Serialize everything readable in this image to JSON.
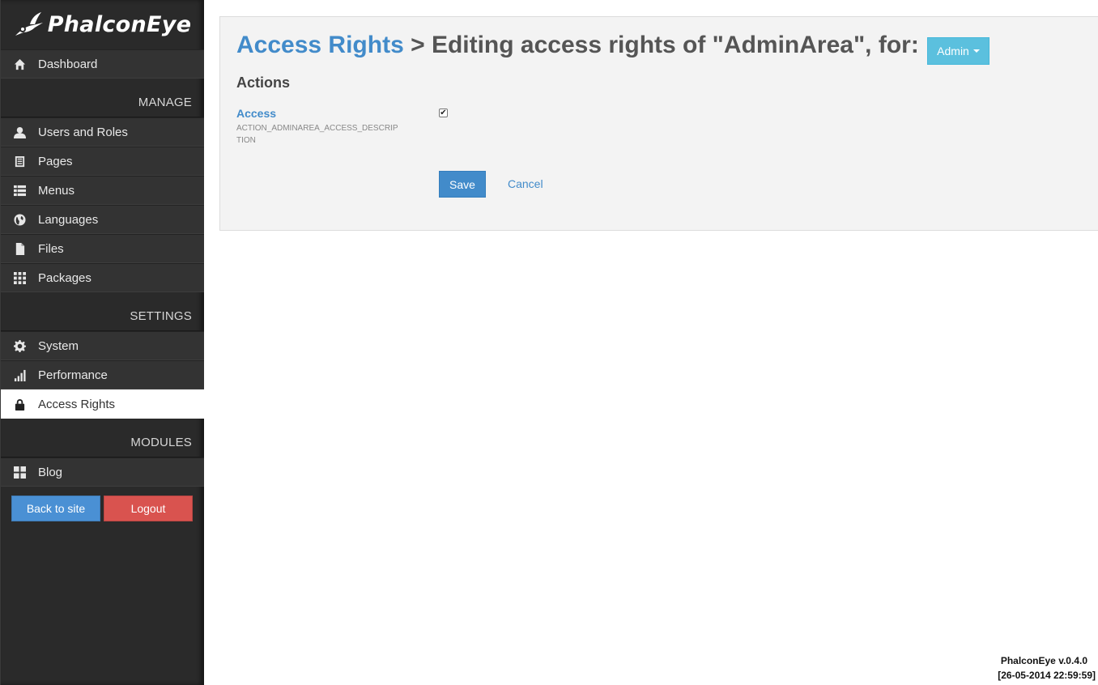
{
  "logo": {
    "text": "PhalconEye"
  },
  "sidebar": {
    "dashboard": {
      "label": "Dashboard",
      "icon": "home-icon"
    },
    "sections": {
      "manage": "MANAGE",
      "settings": "SETTINGS",
      "modules": "MODULES"
    },
    "manage_items": [
      {
        "label": "Users and Roles",
        "icon": "user-icon"
      },
      {
        "label": "Pages",
        "icon": "page-list-icon"
      },
      {
        "label": "Menus",
        "icon": "list-icon"
      },
      {
        "label": "Languages",
        "icon": "globe-icon"
      },
      {
        "label": "Files",
        "icon": "file-icon"
      },
      {
        "label": "Packages",
        "icon": "grid-icon"
      }
    ],
    "settings_items": [
      {
        "label": "System",
        "icon": "gear-icon"
      },
      {
        "label": "Performance",
        "icon": "signal-bars-icon"
      },
      {
        "label": "Access Rights",
        "icon": "lock-icon",
        "active": true
      }
    ],
    "modules_items": [
      {
        "label": "Blog",
        "icon": "tiles-icon"
      }
    ],
    "buttons": {
      "back": "Back to site",
      "logout": "Logout"
    }
  },
  "main": {
    "breadcrumb_link": "Access Rights",
    "title_rest": " > Editing access rights of \"AdminArea\", for:",
    "role_dropdown": "Admin",
    "actions_heading": "Actions",
    "permission": {
      "label": "Access",
      "description": "ACTION_ADMINAREA_ACCESS_DESCRIPTION",
      "checked": true
    },
    "save_label": "Save",
    "cancel_label": "Cancel"
  },
  "footer": {
    "version": "PhalconEye v.0.4.0",
    "timestamp": "[26-05-2014 22:59:59]"
  },
  "colors": {
    "accent": "#428bca",
    "info": "#5bc0de",
    "danger": "#d9534f",
    "sidebar_bg": "#333333"
  }
}
